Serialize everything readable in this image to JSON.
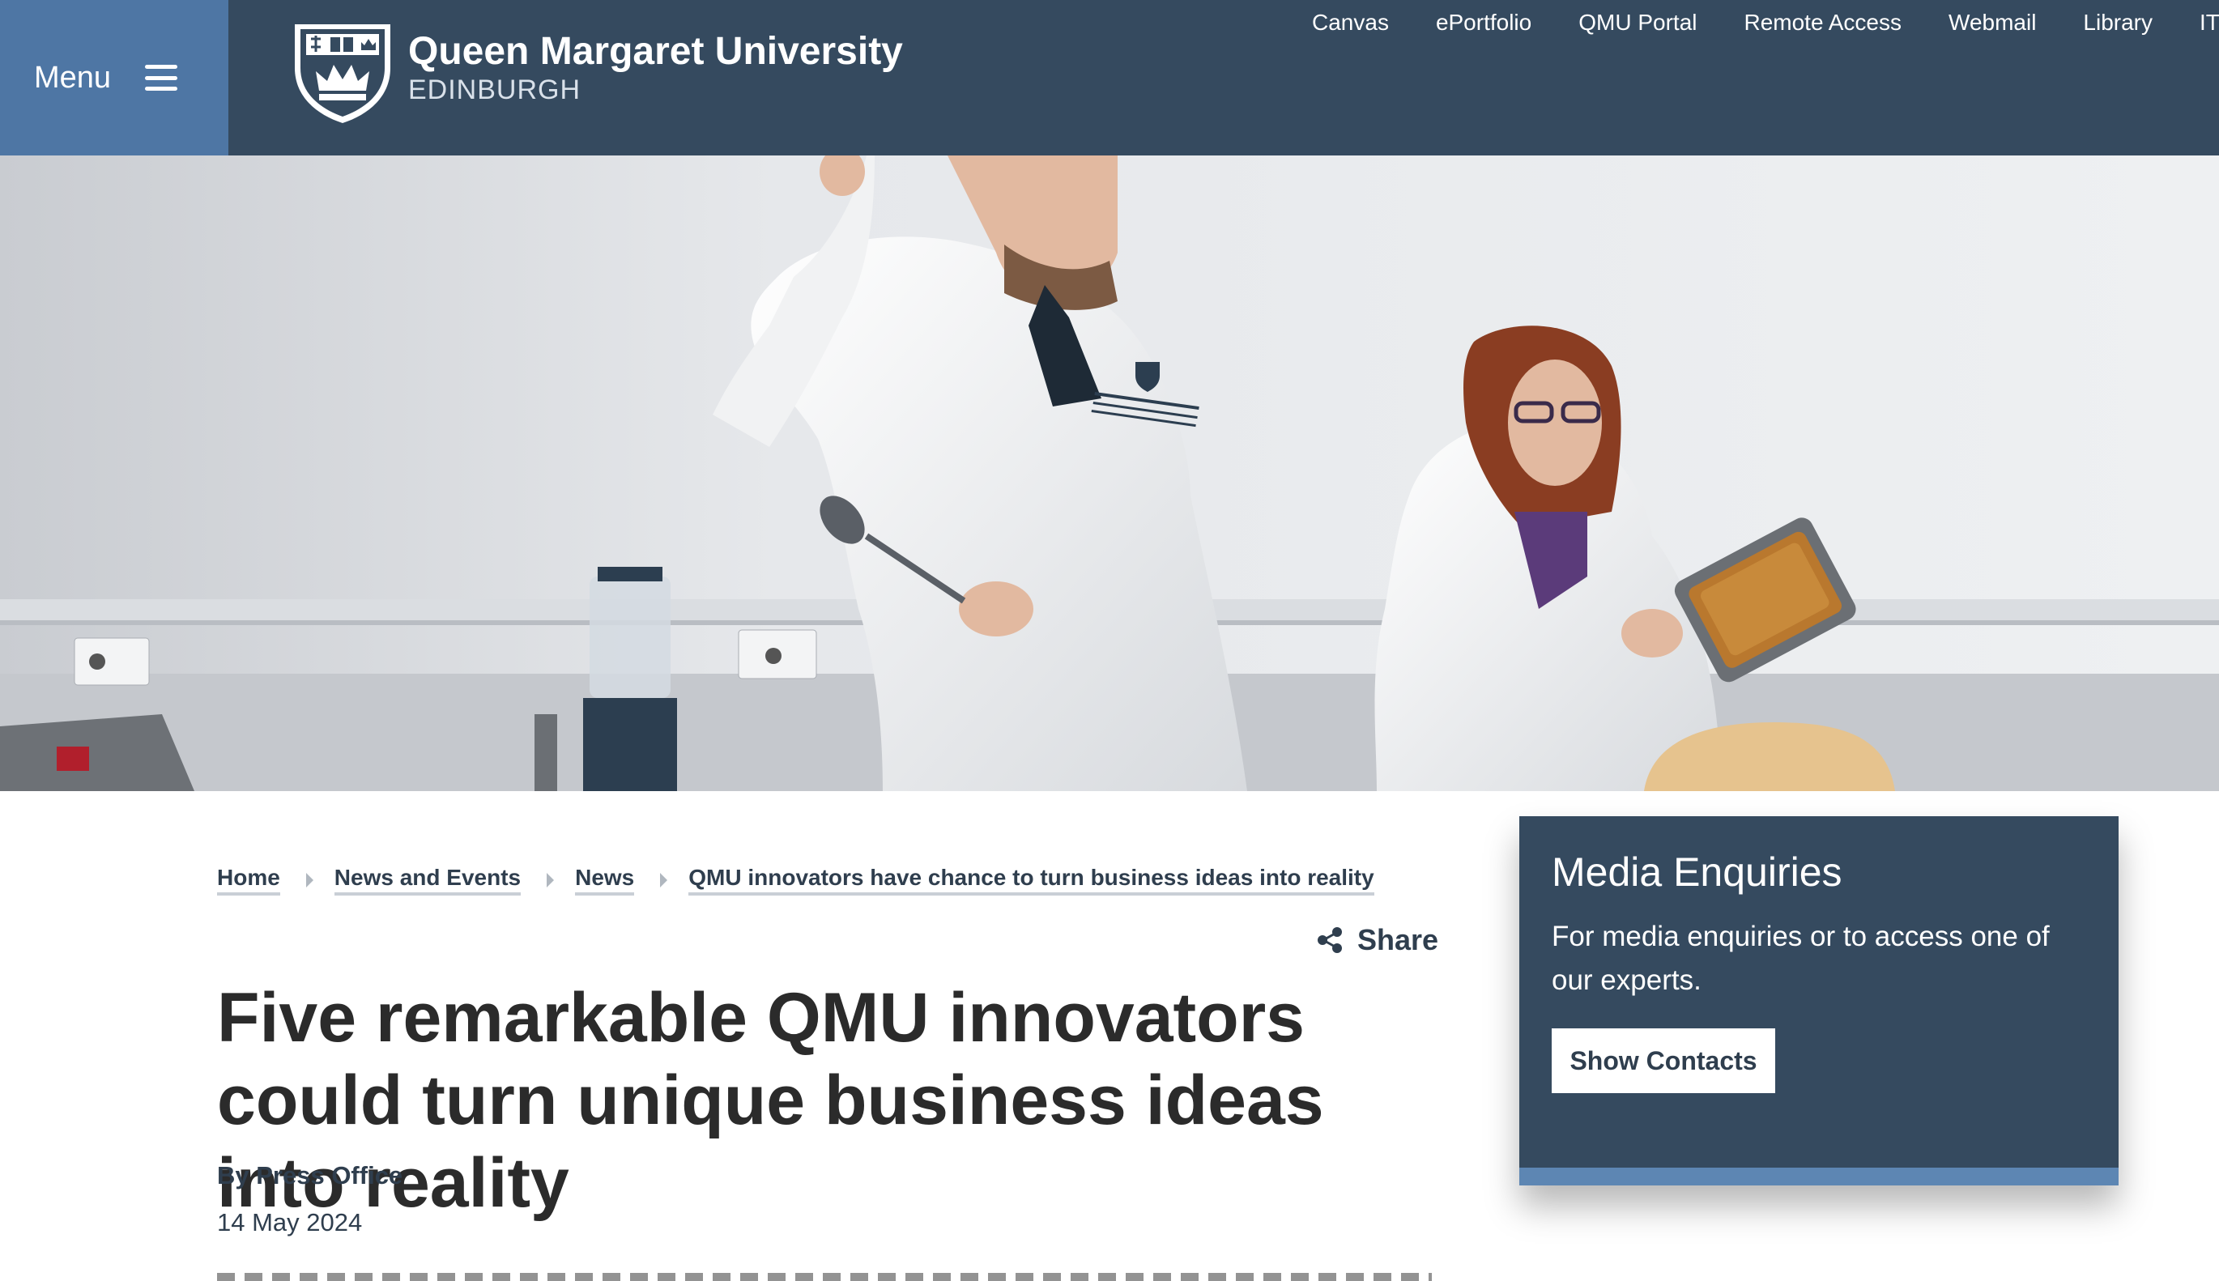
{
  "header": {
    "menu_label": "Menu",
    "university_name": "Queen Margaret University",
    "university_location": "EDINBURGH",
    "quick_links": [
      "Canvas",
      "ePortfolio",
      "QMU Portal",
      "Remote Access",
      "Webmail",
      "Library",
      "IT"
    ]
  },
  "hero": {
    "alt": "Two researchers in white lab coats in a food development kitchen, one holding a spoon and one holding a loaf tin"
  },
  "breadcrumb": {
    "items": [
      "Home",
      "News and Events",
      "News",
      "QMU innovators have chance to turn business ideas into reality"
    ]
  },
  "share_label": "Share",
  "article": {
    "title": "Five remarkable QMU innovators could turn unique business ideas into reality",
    "byline": "By Press Office",
    "date": "14 May 2024"
  },
  "media_enquiries": {
    "heading": "Media Enquiries",
    "text": "For media enquiries or to access one of our experts.",
    "button_label": "Show Contacts"
  },
  "colors": {
    "header_bg": "#354a5f",
    "menu_bg": "#4e76a4",
    "card_accent": "#5d86b3"
  },
  "icons": [
    "hamburger-icon",
    "university-crest-logo",
    "share-icon",
    "breadcrumb-chevron-icon"
  ]
}
